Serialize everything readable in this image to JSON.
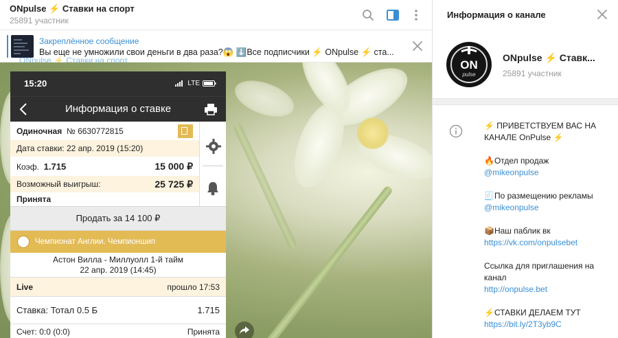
{
  "chat": {
    "title": "ONpulse ⚡️ Ставки на спорт",
    "subtitle": "25891 участник",
    "pinned": {
      "title": "Закреплённое сообщение",
      "text": "Вы еще не умножили свои деньги в два раза?😱 ⬇️Все подписчики ⚡️ ONpulse ⚡️ ста..."
    },
    "quoted_author": "ONpulse ⚡️ Ставки на спорт"
  },
  "phone": {
    "time": "15:20",
    "network": "LTE",
    "nav_title": "Информация о ставке",
    "bet_type": "Одиночная",
    "bet_number": "№ 6630772815",
    "date_label": "Дата ставки: 22 апр. 2019 (15:20)",
    "coef_label": "Коэф.",
    "coef_value": "1.715",
    "amount": "15 000 ₽",
    "win_label": "Возможный выигрыш:",
    "win_value": "25 725 ₽",
    "status": "Принята",
    "sell_label": "Продать за 14 100 ₽",
    "league": "Чемпионат Англии. Чемпионшип",
    "match_line1": "Астон Вилла - Миллуолл 1-й тайм",
    "match_line2": "22 апр. 2019 (14:45)",
    "live_label": "Live",
    "elapsed": "прошло 17:53",
    "stake_label": "Ставка: Тотал 0.5 Б",
    "stake_coef": "1.715",
    "score_label": "Счет: 0:0 (0:0)",
    "score_status": "Принята"
  },
  "panel": {
    "title": "Информация о канале",
    "channel_name": "ONpulse ⚡️ Ставк...",
    "members": "25891 участник",
    "avatar_text": "ON",
    "avatar_sub": "pulse",
    "desc": {
      "greeting": "⚡️ ПРИВЕТСТВУЕМ ВАС НА КАНАЛЕ OnPulse ⚡️",
      "sales_label": "🔥Отдел продаж",
      "sales_link": "@mikeonpulse",
      "ads_label": "🧾По размещению рекламы",
      "ads_link": "@mikeonpulse",
      "vk_label": "📦Наш паблик вк",
      "vk_link": "https://vk.com/onpulsebet",
      "invite_label": "Ссылка для приглашения на канал",
      "invite_link": "http://onpulse.bet",
      "bets_label": "⚡️СТАВКИ ДЕЛАЕМ  ТУТ",
      "bets_link": "https://bit.ly/2T3yb9C"
    }
  },
  "colors": {
    "accent": "#3a8fd4",
    "league": "#e3bb55"
  }
}
